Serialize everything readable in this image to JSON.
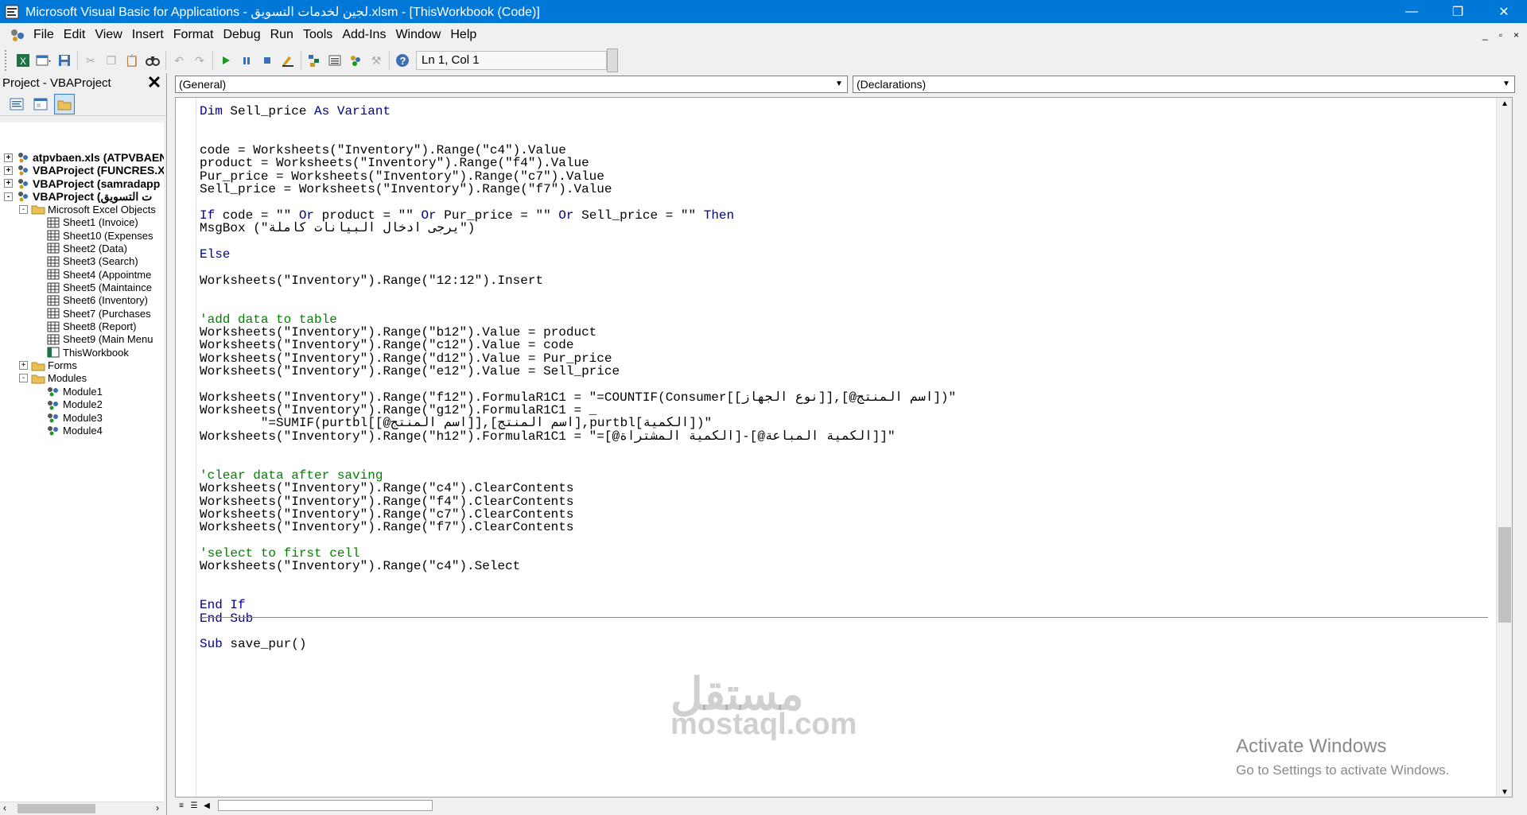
{
  "titlebar": {
    "title": "Microsoft Visual Basic for Applications - لجين لخدمات التسويق.xlsm - [ThisWorkbook (Code)]",
    "minimize": "—",
    "restore": "❐",
    "close": "✕"
  },
  "menu": {
    "items": [
      "File",
      "Edit",
      "View",
      "Insert",
      "Format",
      "Debug",
      "Run",
      "Tools",
      "Add-Ins",
      "Window",
      "Help"
    ],
    "mdi": [
      "_",
      "▫",
      "×"
    ]
  },
  "toolbar": {
    "position": "Ln 1, Col 1"
  },
  "project": {
    "title": "Project - VBAProject",
    "tree": [
      {
        "label": "atpvbaen.xls (ATPVBAEN",
        "level": 0,
        "bold": true,
        "expander": "+",
        "icon": "project-icon"
      },
      {
        "label": "VBAProject (FUNCRES.XL",
        "level": 0,
        "bold": true,
        "expander": "+",
        "icon": "project-icon"
      },
      {
        "label": "VBAProject (samradapp",
        "level": 0,
        "bold": true,
        "expander": "+",
        "icon": "project-icon"
      },
      {
        "label": "VBAProject (ت التسويق",
        "level": 0,
        "bold": true,
        "expander": "-",
        "icon": "project-icon"
      },
      {
        "label": "Microsoft Excel Objects",
        "level": 1,
        "bold": false,
        "expander": "-",
        "icon": "folder-icon"
      },
      {
        "label": "Sheet1 (Invoice)",
        "level": 2,
        "bold": false,
        "expander": "",
        "icon": "sheet-icon"
      },
      {
        "label": "Sheet10 (Expenses",
        "level": 2,
        "bold": false,
        "expander": "",
        "icon": "sheet-icon"
      },
      {
        "label": "Sheet2 (Data)",
        "level": 2,
        "bold": false,
        "expander": "",
        "icon": "sheet-icon"
      },
      {
        "label": "Sheet3 (Search)",
        "level": 2,
        "bold": false,
        "expander": "",
        "icon": "sheet-icon"
      },
      {
        "label": "Sheet4 (Appointme",
        "level": 2,
        "bold": false,
        "expander": "",
        "icon": "sheet-icon"
      },
      {
        "label": "Sheet5 (Maintaince",
        "level": 2,
        "bold": false,
        "expander": "",
        "icon": "sheet-icon"
      },
      {
        "label": "Sheet6 (Inventory)",
        "level": 2,
        "bold": false,
        "expander": "",
        "icon": "sheet-icon"
      },
      {
        "label": "Sheet7 (Purchases",
        "level": 2,
        "bold": false,
        "expander": "",
        "icon": "sheet-icon"
      },
      {
        "label": "Sheet8 (Report)",
        "level": 2,
        "bold": false,
        "expander": "",
        "icon": "sheet-icon"
      },
      {
        "label": "Sheet9 (Main Menu",
        "level": 2,
        "bold": false,
        "expander": "",
        "icon": "sheet-icon"
      },
      {
        "label": "ThisWorkbook",
        "level": 2,
        "bold": false,
        "expander": "",
        "icon": "workbook-icon"
      },
      {
        "label": "Forms",
        "level": 1,
        "bold": false,
        "expander": "+",
        "icon": "folder-icon"
      },
      {
        "label": "Modules",
        "level": 1,
        "bold": false,
        "expander": "-",
        "icon": "folder-icon"
      },
      {
        "label": "Module1",
        "level": 2,
        "bold": false,
        "expander": "",
        "icon": "module-icon"
      },
      {
        "label": "Module2",
        "level": 2,
        "bold": false,
        "expander": "",
        "icon": "module-icon"
      },
      {
        "label": "Module3",
        "level": 2,
        "bold": false,
        "expander": "",
        "icon": "module-icon"
      },
      {
        "label": "Module4",
        "level": 2,
        "bold": false,
        "expander": "",
        "icon": "module-icon"
      }
    ]
  },
  "editor": {
    "object_combo": "(General)",
    "procedure_combo": "(Declarations)",
    "lines": [
      {
        "text": "Dim Sell_price As Variant",
        "kind": "code"
      },
      {
        "text": "",
        "kind": "code"
      },
      {
        "text": "",
        "kind": "code"
      },
      {
        "text": "code = Worksheets(\"Inventory\").Range(\"c4\").Value",
        "kind": "code"
      },
      {
        "text": "product = Worksheets(\"Inventory\").Range(\"f4\").Value",
        "kind": "code"
      },
      {
        "text": "Pur_price = Worksheets(\"Inventory\").Range(\"c7\").Value",
        "kind": "code"
      },
      {
        "text": "Sell_price = Worksheets(\"Inventory\").Range(\"f7\").Value",
        "kind": "code"
      },
      {
        "text": "",
        "kind": "code"
      },
      {
        "text": "If code = \"\" Or product = \"\" Or Pur_price = \"\" Or Sell_price = \"\" Then",
        "kind": "code"
      },
      {
        "text": "MsgBox (\"يرجى ادخال البيانات كاملة\")",
        "kind": "code"
      },
      {
        "text": "",
        "kind": "code"
      },
      {
        "text": "Else",
        "kind": "keyword"
      },
      {
        "text": "",
        "kind": "code"
      },
      {
        "text": "Worksheets(\"Inventory\").Range(\"12:12\").Insert",
        "kind": "code"
      },
      {
        "text": "",
        "kind": "code"
      },
      {
        "text": "",
        "kind": "code"
      },
      {
        "text": "'add data to table",
        "kind": "comment"
      },
      {
        "text": "Worksheets(\"Inventory\").Range(\"b12\").Value = product",
        "kind": "code"
      },
      {
        "text": "Worksheets(\"Inventory\").Range(\"c12\").Value = code",
        "kind": "code"
      },
      {
        "text": "Worksheets(\"Inventory\").Range(\"d12\").Value = Pur_price",
        "kind": "code"
      },
      {
        "text": "Worksheets(\"Inventory\").Range(\"e12\").Value = Sell_price",
        "kind": "code"
      },
      {
        "text": "",
        "kind": "code"
      },
      {
        "text": "Worksheets(\"Inventory\").Range(\"f12\").FormulaR1C1 = \"=COUNTIF(Consumer[[نوع الجهاز]],[@اسم المنتج])\"",
        "kind": "code"
      },
      {
        "text": "Worksheets(\"Inventory\").Range(\"g12\").FormulaR1C1 = _",
        "kind": "code"
      },
      {
        "text": "        \"=SUMIF(purtbl[[@اسم المنتج]],[اسم المنتج],purtbl[الكمية])\"",
        "kind": "code"
      },
      {
        "text": "Worksheets(\"Inventory\").Range(\"h12\").FormulaR1C1 = \"=[@الكمية المشتراة]-[@الكمية المباعة]]\"",
        "kind": "code"
      },
      {
        "text": "",
        "kind": "code"
      },
      {
        "text": "",
        "kind": "code"
      },
      {
        "text": "'clear data after saving",
        "kind": "comment"
      },
      {
        "text": "Worksheets(\"Inventory\").Range(\"c4\").ClearContents",
        "kind": "code"
      },
      {
        "text": "Worksheets(\"Inventory\").Range(\"f4\").ClearContents",
        "kind": "code"
      },
      {
        "text": "Worksheets(\"Inventory\").Range(\"c7\").ClearContents",
        "kind": "code"
      },
      {
        "text": "Worksheets(\"Inventory\").Range(\"f7\").ClearContents",
        "kind": "code"
      },
      {
        "text": "",
        "kind": "code"
      },
      {
        "text": "'select to first cell",
        "kind": "comment"
      },
      {
        "text": "Worksheets(\"Inventory\").Range(\"c4\").Select",
        "kind": "code"
      },
      {
        "text": "",
        "kind": "code"
      },
      {
        "text": "",
        "kind": "code"
      },
      {
        "text": "End If",
        "kind": "keyword"
      },
      {
        "text": "End Sub",
        "kind": "keyword"
      },
      {
        "text": "",
        "kind": "code"
      },
      {
        "text": "Sub save_pur()",
        "kind": "code"
      }
    ]
  },
  "watermark": {
    "arabic": "مستقل",
    "latin": "mostaql.com"
  },
  "activate": {
    "line1": "Activate Windows",
    "line2": "Go to Settings to activate Windows."
  },
  "colors": {
    "titlebar": "#0078d7",
    "keyword": "#00008b",
    "comment": "#008000"
  }
}
